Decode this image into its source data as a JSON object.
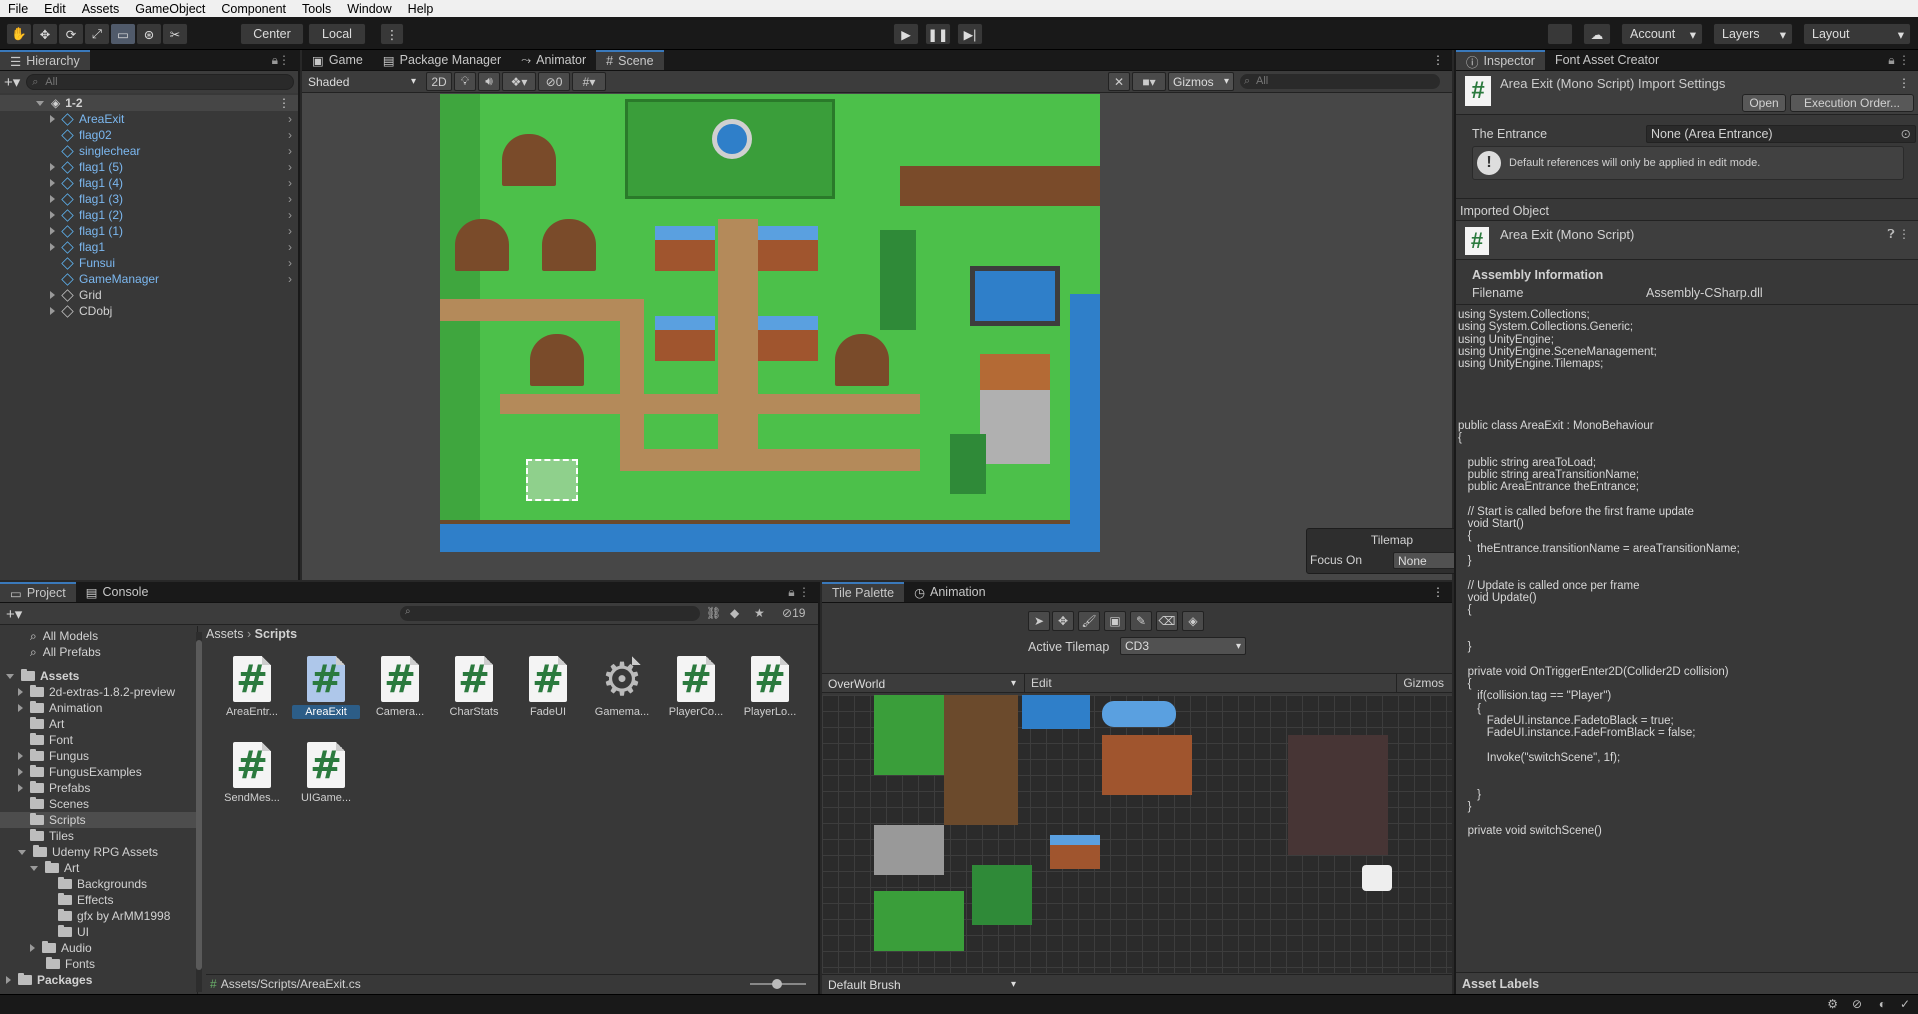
{
  "menu": [
    "File",
    "Edit",
    "Assets",
    "GameObject",
    "Component",
    "Tools",
    "Window",
    "Help"
  ],
  "toolbar": {
    "pivot": "Center",
    "space": "Local",
    "account": "Account",
    "layers": "Layers",
    "layout": "Layout"
  },
  "hierarchy": {
    "tab": "Hierarchy",
    "search_placeholder": "All",
    "scene": "1-2",
    "items": [
      "AreaExit",
      "flag02",
      "singlechear",
      "flag1 (5)",
      "flag1 (4)",
      "flag1 (3)",
      "flag1 (2)",
      "flag1 (1)",
      "flag1",
      "Funsui",
      "GameManager",
      "Grid",
      "CDobj"
    ]
  },
  "scene_tabs": {
    "game": "Game",
    "package": "Package Manager",
    "animator": "Animator",
    "scene": "Scene"
  },
  "scene_bar": {
    "shading": "Shaded",
    "mode_2d": "2D",
    "hidden_count": "0",
    "gizmos": "Gizmos",
    "search_placeholder": "All"
  },
  "tilemap_overlay": {
    "title": "Tilemap",
    "focus_label": "Focus On",
    "focus_value": "None"
  },
  "project": {
    "tab": "Project",
    "console_tab": "Console",
    "hidden_count": "19",
    "favorites": [
      "All Models",
      "All Prefabs"
    ],
    "tree": [
      "Assets",
      "2d-extras-1.8.2-preview",
      "Animation",
      "Art",
      "Font",
      "Fungus",
      "FungusExamples",
      "Prefabs",
      "Scenes",
      "Scripts",
      "Tiles",
      "Udemy RPG Assets",
      "Art",
      "Backgrounds",
      "Effects",
      "gfx by ArMM1998",
      "UI",
      "Audio",
      "Fonts",
      "Packages"
    ],
    "breadcrumb": [
      "Assets",
      "Scripts"
    ],
    "assets": [
      "AreaEntr...",
      "AreaExit",
      "Camera...",
      "CharStats",
      "FadeUI",
      "Gamema...",
      "PlayerCo...",
      "PlayerLo...",
      "SendMes...",
      "UIGame..."
    ],
    "path": "Assets/Scripts/AreaExit.cs"
  },
  "tile_palette": {
    "tab": "Tile Palette",
    "animation_tab": "Animation",
    "active_tilemap_label": "Active Tilemap",
    "active_tilemap": "CD3",
    "palette": "OverWorld",
    "edit": "Edit",
    "gizmos": "Gizmos",
    "brush": "Default Brush"
  },
  "inspector": {
    "tab": "Inspector",
    "tab2": "Font Asset Creator",
    "title": "Area Exit (Mono Script) Import Settings",
    "open": "Open",
    "exec": "Execution Order...",
    "field_label": "The Entrance",
    "field_value": "None (Area Entrance)",
    "warning": "Default references will only be applied in edit mode.",
    "imported_label": "Imported Object",
    "imported_title": "Area Exit (Mono Script)",
    "assembly_header": "Assembly Information",
    "filename_label": "Filename",
    "filename_value": "Assembly-CSharp.dll",
    "code": "using System.Collections;\nusing System.Collections.Generic;\nusing UnityEngine;\nusing UnityEngine.SceneManagement;\nusing UnityEngine.Tilemaps;\n\n\n\n\npublic class AreaExit : MonoBehaviour\n{\n\n   public string areaToLoad;\n   public string areaTransitionName;\n   public AreaEntrance theEntrance;\n\n   // Start is called before the first frame update\n   void Start()\n   {\n      theEntrance.transitionName = areaTransitionName;\n   }\n\n   // Update is called once per frame\n   void Update()\n   {\n\n\n   }\n\n   private void OnTriggerEnter2D(Collider2D collision)\n   {\n      if(collision.tag == \"Player\")\n      {\n         FadeUI.instance.FadetoBlack = true;\n         FadeUI.instance.FadeFromBlack = false;\n\n         Invoke(\"switchScene\", 1f);\n\n\n      }\n   }\n\n   private void switchScene()",
    "asset_labels": "Asset Labels"
  },
  "colors": {
    "accent": "#3a79bb",
    "grass": "#4cc04a",
    "water": "#2f7fc9",
    "path": "#b48a5a"
  }
}
